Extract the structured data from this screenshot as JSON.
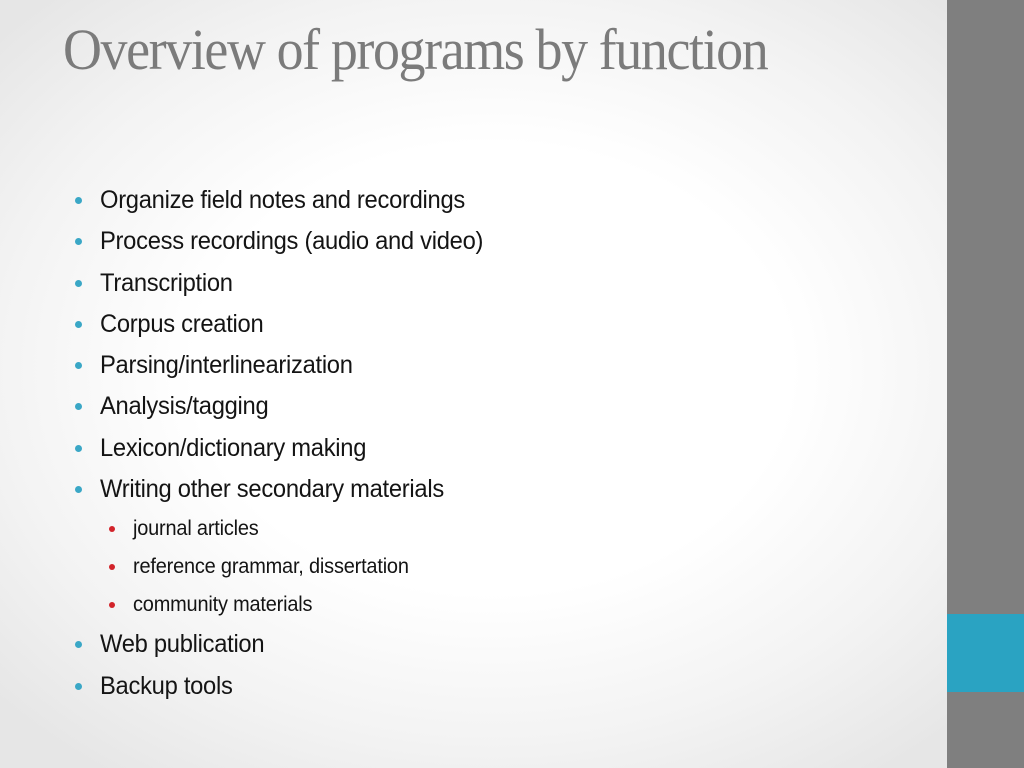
{
  "slide": {
    "title": "Overview of programs by function",
    "colors": {
      "title": "#7b7b7b",
      "body_text": "#141414",
      "bullet_level1": "#3aa7c6",
      "bullet_level2": "#d2232a",
      "sidebar": "#7f7f7f",
      "sidebar_accent": "#2aa3c2"
    },
    "bullets": [
      {
        "text": "Organize field notes and recordings",
        "level": 1
      },
      {
        "text": "Process recordings (audio and video)",
        "level": 1
      },
      {
        "text": "Transcription",
        "level": 1
      },
      {
        "text": "Corpus creation",
        "level": 1
      },
      {
        "text": "Parsing/interlinearization",
        "level": 1
      },
      {
        "text": "Analysis/tagging",
        "level": 1
      },
      {
        "text": "Lexicon/dictionary making",
        "level": 1
      },
      {
        "text": "Writing other secondary materials",
        "level": 1
      },
      {
        "text": "journal articles",
        "level": 2
      },
      {
        "text": "reference grammar, dissertation",
        "level": 2
      },
      {
        "text": "community materials",
        "level": 2
      },
      {
        "text": "Web publication",
        "level": 1
      },
      {
        "text": "Backup tools",
        "level": 1
      }
    ]
  }
}
